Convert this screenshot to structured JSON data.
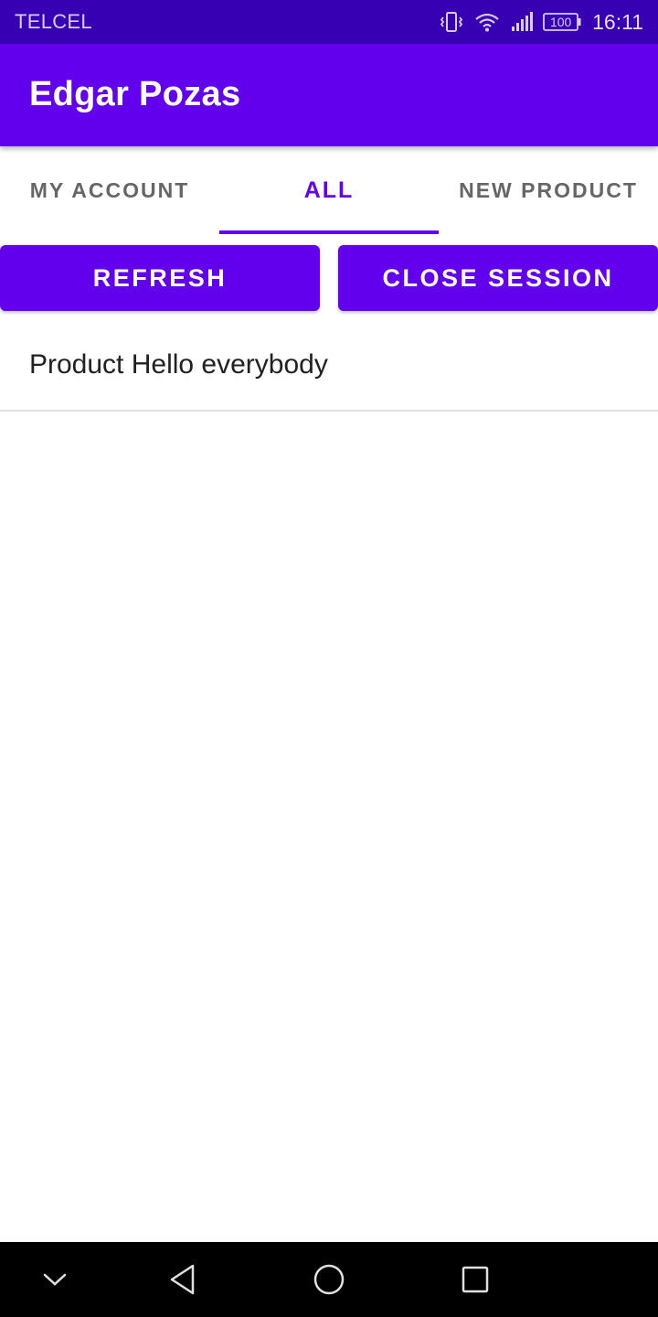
{
  "status_bar": {
    "carrier": "TELCEL",
    "battery": "100",
    "time": "16:11",
    "icons": [
      "vibrate-icon",
      "wifi-icon",
      "signal-icon",
      "battery-icon"
    ]
  },
  "app_bar": {
    "title": "Edgar Pozas"
  },
  "tabs": [
    {
      "label": "MY ACCOUNT",
      "selected": false
    },
    {
      "label": "ALL",
      "selected": true
    },
    {
      "label": "NEW PRODUCT",
      "selected": false
    }
  ],
  "actions": {
    "refresh_label": "REFRESH",
    "close_session_label": "CLOSE SESSION"
  },
  "products": [
    {
      "label": "Product Hello everybody"
    }
  ],
  "nav_bar": {
    "icons": [
      "chevron-down-icon",
      "back-icon",
      "home-icon",
      "recent-apps-icon"
    ]
  },
  "colors": {
    "primary": "#6200ee",
    "primary_dark": "#3700b3",
    "on_primary": "#ffffff",
    "tab_inactive": "#666666"
  }
}
